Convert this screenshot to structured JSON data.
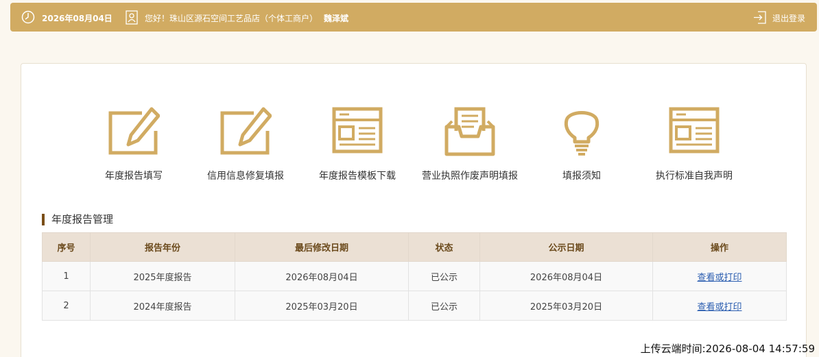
{
  "header": {
    "date": "2026年08月04日",
    "greeting": "您好！珠山区源石空间工艺品店（个体工商户）",
    "person": "魏泽斌",
    "logout_label": "退出登录"
  },
  "features": [
    {
      "label": "年度报告填写",
      "icon": "edit-icon"
    },
    {
      "label": "信用信息修复填报",
      "icon": "edit-icon"
    },
    {
      "label": "年度报告模板下载",
      "icon": "template-icon"
    },
    {
      "label": "营业执照作废声明填报",
      "icon": "inbox-icon"
    },
    {
      "label": "填报须知",
      "icon": "lightbulb-icon"
    },
    {
      "label": "执行标准自我声明",
      "icon": "template-icon"
    }
  ],
  "section_title": "年度报告管理",
  "table": {
    "headers": [
      "序号",
      "报告年份",
      "最后修改日期",
      "状态",
      "公示日期",
      "操作"
    ],
    "rows": [
      [
        "1",
        "2025年度报告",
        "2026年08月04日",
        "已公示",
        "2026年08月04日",
        "查看或打印"
      ],
      [
        "2",
        "2024年度报告",
        "2025年03月20日",
        "已公示",
        "2025年03月20日",
        "查看或打印"
      ]
    ]
  },
  "upload_time": "上传云端时间:2026-08-04 14:57:59",
  "colors": {
    "accent": "#d1ab62",
    "section_bar": "#7a4e17",
    "link": "#2a5db0"
  }
}
